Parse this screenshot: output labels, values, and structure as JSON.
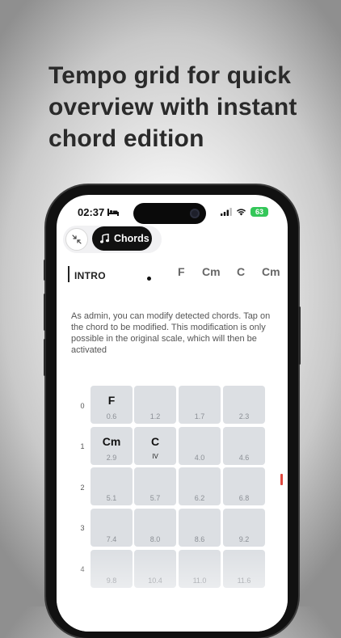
{
  "headline": "Tempo grid for quick overview with instant chord edition",
  "status_bar": {
    "time": "02:37",
    "battery": "63"
  },
  "toolbar": {
    "chords_label": "Chords"
  },
  "song": {
    "section": "INTRO",
    "chord_strip": [
      "F",
      "Cm",
      "C",
      "Cm"
    ]
  },
  "info_text": "As admin, you can modify detected chords. Tap on the chord to be modified. This modification is only possible in the original scale, which will then be activated",
  "grid": {
    "rows": [
      {
        "label": "0",
        "cells": [
          {
            "chord": "F",
            "time": "0.6"
          },
          {
            "chord": "",
            "time": "1.2"
          },
          {
            "chord": "",
            "time": "1.7"
          },
          {
            "chord": "",
            "time": "2.3"
          }
        ]
      },
      {
        "label": "1",
        "cells": [
          {
            "chord": "Cm",
            "time": "2.9"
          },
          {
            "chord": "C",
            "degree": "IV"
          },
          {
            "chord": "",
            "time": "4.0"
          },
          {
            "chord": "",
            "time": "4.6"
          }
        ]
      },
      {
        "label": "2",
        "cells": [
          {
            "chord": "",
            "time": "5.1"
          },
          {
            "chord": "",
            "time": "5.7"
          },
          {
            "chord": "",
            "time": "6.2"
          },
          {
            "chord": "",
            "time": "6.8"
          }
        ]
      },
      {
        "label": "3",
        "cells": [
          {
            "chord": "",
            "time": "7.4"
          },
          {
            "chord": "",
            "time": "8.0"
          },
          {
            "chord": "",
            "time": "8.6"
          },
          {
            "chord": "",
            "time": "9.2"
          }
        ]
      },
      {
        "label": "4",
        "cells": [
          {
            "chord": "",
            "time": "9.8"
          },
          {
            "chord": "",
            "time": "10.4"
          },
          {
            "chord": "",
            "time": "11.0"
          },
          {
            "chord": "",
            "time": "11.6"
          }
        ]
      }
    ]
  },
  "icons": {
    "shrink": "collapse-arrows-icon",
    "chords": "music-note-icon",
    "bed": "bed-icon",
    "signal": "cellular-signal-icon",
    "wifi": "wifi-icon"
  },
  "colors": {
    "accent": "#111111",
    "cell": "#dcdfe3",
    "battery": "#34c759",
    "marker": "#e0483e"
  }
}
